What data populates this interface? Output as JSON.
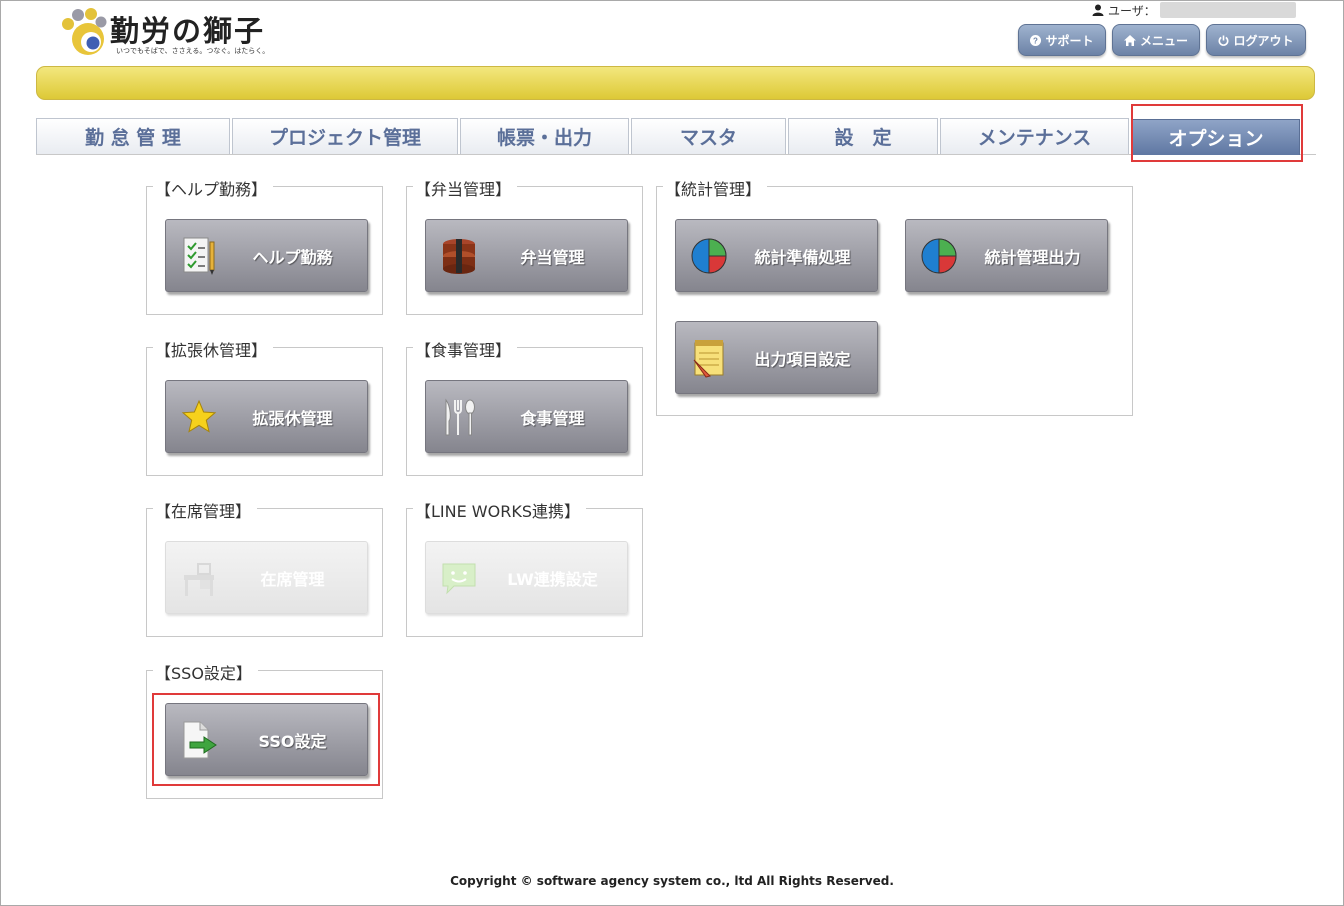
{
  "app": {
    "title": "勤労の獅子",
    "tagline": "いつでもそばで、ささえる。つなぐ。はたらく。"
  },
  "user": {
    "label": "ユーザ："
  },
  "header_buttons": {
    "support": "サポート",
    "menu": "メニュー",
    "logout": "ログアウト"
  },
  "tabs": [
    {
      "label": "勤 怠 管 理",
      "active": false
    },
    {
      "label": "プロジェクト管理",
      "active": false
    },
    {
      "label": "帳票・出力",
      "active": false
    },
    {
      "label": "マスタ",
      "active": false
    },
    {
      "label": "設　定",
      "active": false
    },
    {
      "label": "メンテナンス",
      "active": false
    },
    {
      "label": "オプション",
      "active": true
    }
  ],
  "groups": {
    "help": {
      "title": "【ヘルプ勤務】",
      "buttons": [
        {
          "label": "ヘルプ勤務",
          "icon": "checklist-icon",
          "enabled": true
        }
      ]
    },
    "bento": {
      "title": "【弁当管理】",
      "buttons": [
        {
          "label": "弁当管理",
          "icon": "lunchbox-icon",
          "enabled": true
        }
      ]
    },
    "stats": {
      "title": "【統計管理】",
      "buttons": [
        {
          "label": "統計準備処理",
          "icon": "pie-chart-icon",
          "enabled": true
        },
        {
          "label": "統計管理出力",
          "icon": "pie-chart-icon",
          "enabled": true
        },
        {
          "label": "出力項目設定",
          "icon": "notepad-icon",
          "enabled": true
        }
      ]
    },
    "leave": {
      "title": "【拡張休管理】",
      "buttons": [
        {
          "label": "拡張休管理",
          "icon": "star-icon",
          "enabled": true
        }
      ]
    },
    "meal": {
      "title": "【食事管理】",
      "buttons": [
        {
          "label": "食事管理",
          "icon": "cutlery-icon",
          "enabled": true
        }
      ]
    },
    "presence": {
      "title": "【在席管理】",
      "buttons": [
        {
          "label": "在席管理",
          "icon": "desk-icon",
          "enabled": false
        }
      ]
    },
    "lineworks": {
      "title": "【LINE WORKS連携】",
      "buttons": [
        {
          "label": "LW連携設定",
          "icon": "chat-bubble-icon",
          "enabled": false
        }
      ]
    },
    "sso": {
      "title": "【SSO設定】",
      "buttons": [
        {
          "label": "SSO設定",
          "icon": "document-arrow-icon",
          "enabled": true
        }
      ]
    }
  },
  "footer": {
    "copyright": "Copyright © software agency system co., ltd All Rights Reserved."
  },
  "colors": {
    "tab_active": "#5f77a2",
    "highlight": "#e03a3a",
    "header_bar": "#ddc936"
  }
}
